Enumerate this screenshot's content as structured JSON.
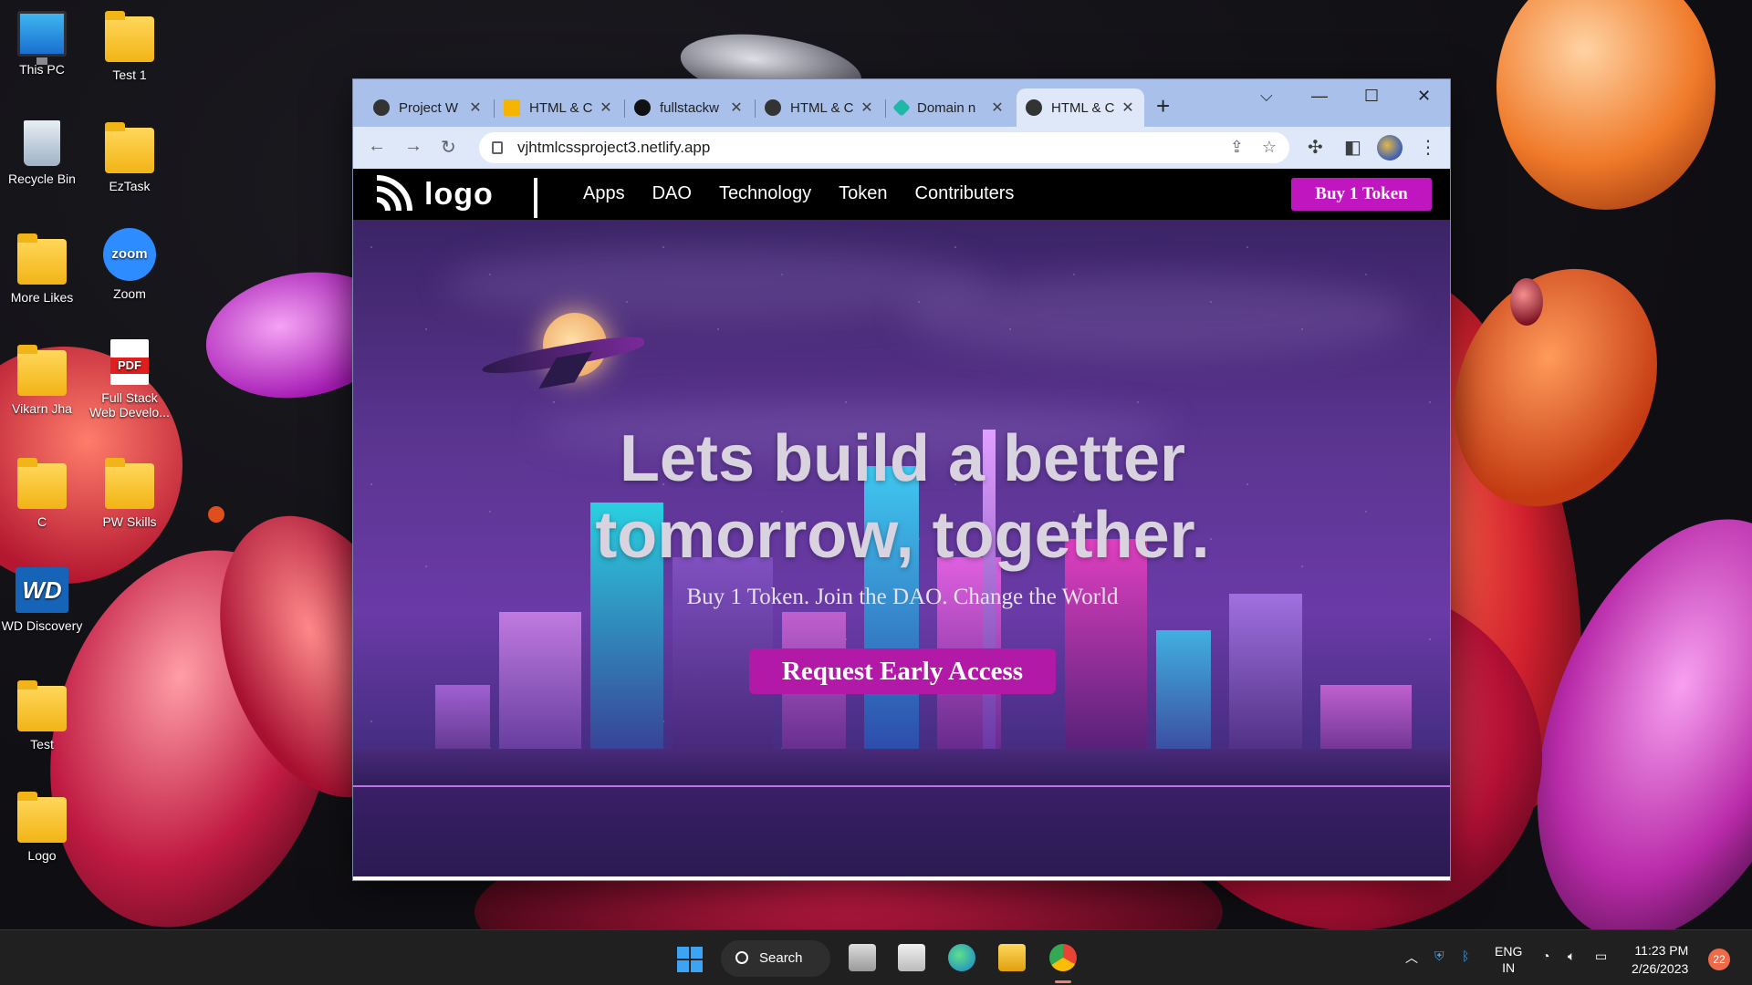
{
  "desktop": {
    "icons": [
      {
        "label": "This PC",
        "icon": "this-pc-icon"
      },
      {
        "label": "Test 1",
        "icon": "chrome-folder-icon"
      },
      {
        "label": "Recycle Bin",
        "icon": "recycle-bin-icon"
      },
      {
        "label": "EzTask",
        "icon": "folder-icon"
      },
      {
        "label": "More Likes",
        "icon": "folder-icon"
      },
      {
        "label": "Zoom",
        "icon": "zoom-icon"
      },
      {
        "label": "Vikarn Jha",
        "icon": "user-folder-icon"
      },
      {
        "label": "Full Stack Web Develo...",
        "icon": "pdf-icon"
      },
      {
        "label": "C",
        "icon": "folder-icon"
      },
      {
        "label": "PW Skills",
        "icon": "folder-icon"
      },
      {
        "label": "WD Discovery",
        "icon": "wd-icon"
      },
      {
        "label": "Test",
        "icon": "chrome-folder-icon"
      },
      {
        "label": "Logo",
        "icon": "bank-folder-icon"
      }
    ]
  },
  "browser": {
    "tabs": [
      {
        "title": "Project W",
        "icon": "notion-icon",
        "active": false
      },
      {
        "title": "HTML & C",
        "icon": "drive-icon",
        "active": false
      },
      {
        "title": "fullstackw",
        "icon": "github-icon",
        "active": false
      },
      {
        "title": "HTML & C",
        "icon": "globe-icon",
        "active": false
      },
      {
        "title": "Domain n",
        "icon": "netlify-icon",
        "active": false
      },
      {
        "title": "HTML & C",
        "icon": "globe-icon",
        "active": true
      }
    ],
    "url": "vjhtmlcssproject3.netlify.app"
  },
  "site": {
    "logo_text": "logo",
    "nav_links": [
      "Apps",
      "DAO",
      "Technology",
      "Token",
      "Contributers"
    ],
    "buy_button": "Buy 1 Token",
    "headline_line1": "Lets build a better",
    "headline_line2": "tomorrow, together.",
    "subheadline": "Buy 1 Token. Join the DAO. Change the World",
    "cta": "Request Early Access",
    "colors": {
      "accent": "#c016c0",
      "nav_bg": "#000000"
    }
  },
  "taskbar": {
    "search_label": "Search",
    "language_line1": "ENG",
    "language_line2": "IN",
    "time": "11:23 PM",
    "date": "2/26/2023",
    "notification_count": "22"
  }
}
